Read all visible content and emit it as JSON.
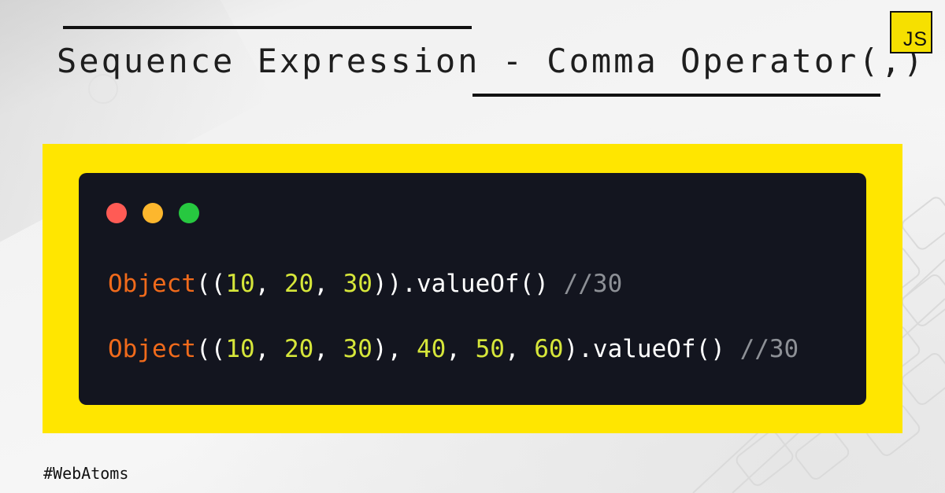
{
  "title": "Sequence Expression - Comma Operator(,)",
  "badge": {
    "label": "JS"
  },
  "window": {
    "dots": [
      "close",
      "minimize",
      "maximize"
    ]
  },
  "code": {
    "line1": {
      "keyword": "Object",
      "open": "((",
      "n1": "10",
      "c1": ", ",
      "n2": "20",
      "c2": ", ",
      "n3": "30",
      "tail": ")).valueOf() ",
      "comment": "//30"
    },
    "line2": {
      "keyword": "Object",
      "open": "((",
      "n1": "10",
      "c1": ", ",
      "n2": "20",
      "c2": ", ",
      "n3": "30",
      "c3": "), ",
      "n4": "40",
      "c4": ", ",
      "n5": "50",
      "c5": ", ",
      "n6": "60",
      "tail": ").valueOf() ",
      "comment": "//30"
    }
  },
  "footer": {
    "hashtag": "#WebAtoms"
  },
  "colors": {
    "frame": "#ffe600",
    "window_bg": "#13151f",
    "keyword": "#f06a1b",
    "number": "#d6e63a",
    "comment": "#8d9096",
    "dot_red": "#ff5b55",
    "dot_yellow": "#fdb72d",
    "dot_green": "#27c840"
  }
}
